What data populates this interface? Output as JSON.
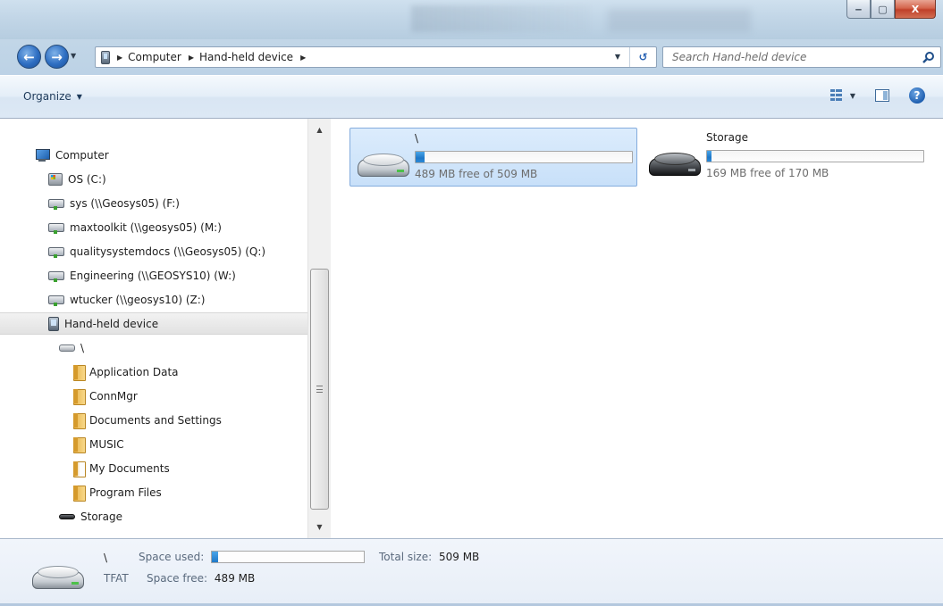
{
  "window": {
    "minimize_glyph": "‒",
    "maximize_glyph": "▢",
    "close_glyph": "X"
  },
  "address": {
    "breadcrumbs": [
      "Computer",
      "Hand-held device"
    ],
    "separator_glyph": "▶"
  },
  "search": {
    "placeholder": "Search Hand-held device",
    "value": ""
  },
  "toolbar": {
    "organize_label": "Organize",
    "icons": [
      "views-icon",
      "preview-pane-icon",
      "help-icon"
    ]
  },
  "nav_pane": {
    "items": [
      {
        "label": "Computer",
        "icon": "computer-icon"
      },
      {
        "label": "OS (C:)",
        "icon": "os-drive-icon"
      },
      {
        "label": "sys (\\\\Geosys05) (F:)",
        "icon": "network-drive-icon"
      },
      {
        "label": "maxtoolkit (\\\\geosys05) (M:)",
        "icon": "network-drive-icon"
      },
      {
        "label": "qualitysystemdocs (\\\\Geosys05) (Q:)",
        "icon": "network-drive-icon"
      },
      {
        "label": "Engineering (\\\\GEOSYS10) (W:)",
        "icon": "network-drive-icon"
      },
      {
        "label": "wtucker (\\\\geosys10) (Z:)",
        "icon": "network-drive-icon"
      },
      {
        "label": "Hand-held device",
        "icon": "device-icon",
        "selected": true
      },
      {
        "label": "\\",
        "icon": "drive-icon"
      },
      {
        "label": "Application Data",
        "icon": "folder-icon"
      },
      {
        "label": "ConnMgr",
        "icon": "folder-icon"
      },
      {
        "label": "Documents and Settings",
        "icon": "folder-icon"
      },
      {
        "label": "MUSIC",
        "icon": "folder-icon"
      },
      {
        "label": "My Documents",
        "icon": "documents-folder-icon"
      },
      {
        "label": "Program Files",
        "icon": "folder-icon"
      },
      {
        "label": "Storage",
        "icon": "storage-drive-icon"
      }
    ]
  },
  "content": {
    "drives": [
      {
        "name": "\\",
        "free_text": "489 MB free of 509 MB",
        "used_fraction": 0.04,
        "selected": true
      },
      {
        "name": "Storage",
        "free_text": "169 MB free of 170 MB",
        "used_fraction": 0.006,
        "selected": false
      }
    ]
  },
  "details": {
    "name": "\\",
    "filesystem": "TFAT",
    "space_used_label": "Space used:",
    "space_used_fraction": 0.04,
    "space_free_label": "Space free:",
    "space_free_value": "489 MB",
    "total_size_label": "Total size:",
    "total_size_value": "509 MB"
  }
}
